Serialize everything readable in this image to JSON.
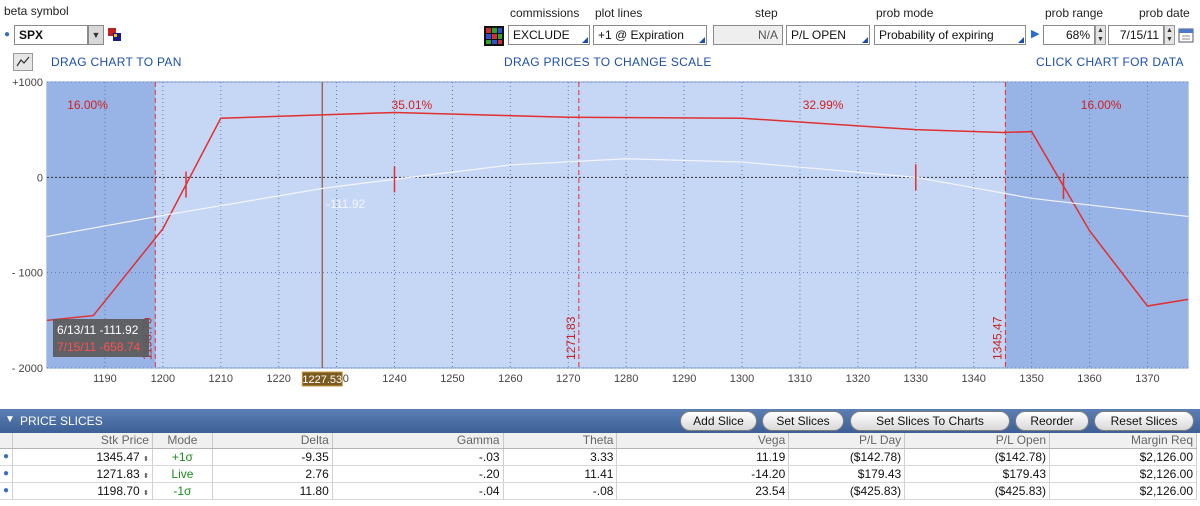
{
  "controls": {
    "beta_symbol_label": "beta symbol",
    "symbol": "SPX",
    "commissions_label": "commissions",
    "commissions_value": "EXCLUDE",
    "plot_lines_label": "plot lines",
    "plot_lines_value": "+1 @ Expiration",
    "step_label": "step",
    "step_value": "N/A",
    "pl_mode_value": "P/L OPEN",
    "prob_mode_label": "prob mode",
    "prob_mode_value": "Probability of expiring",
    "prob_range_label": "prob range",
    "prob_range_value": "68%",
    "prob_date_label": "prob date",
    "prob_date_value": "7/15/11"
  },
  "hints": {
    "pan": "DRAG CHART TO PAN",
    "scale": "DRAG PRICES TO CHANGE SCALE",
    "data": "CLICK CHART FOR DATA"
  },
  "chart_data": {
    "type": "line",
    "xlim": [
      1180,
      1377
    ],
    "ylim": [
      -2000,
      1000
    ],
    "x_ticks": [
      1190,
      1200,
      1210,
      1220,
      1230,
      1240,
      1250,
      1260,
      1270,
      1280,
      1290,
      1300,
      1310,
      1320,
      1330,
      1340,
      1350,
      1360,
      1370
    ],
    "y_ticks": [
      {
        "value": 1000,
        "label": "+1000"
      },
      {
        "value": 0,
        "label": "0"
      },
      {
        "value": -1000,
        "label": "- 1000"
      },
      {
        "value": -2000,
        "label": "- 2000"
      }
    ],
    "series": [
      {
        "color": "#e03030",
        "x": [
          1180,
          1188,
          1200,
          1210,
          1240,
          1270,
          1300,
          1330,
          1345,
          1350,
          1360,
          1370,
          1377
        ],
        "y": [
          -1500,
          -1450,
          -540,
          620,
          680,
          630,
          620,
          500,
          470,
          480,
          -560,
          -1350,
          -1280
        ]
      },
      {
        "color": "#f4f4ff",
        "x": [
          1180,
          1200,
          1228,
          1260,
          1280,
          1300,
          1330,
          1350,
          1377
        ],
        "y": [
          -620,
          -400,
          -112,
          130,
          195,
          160,
          0,
          -220,
          -410
        ]
      }
    ],
    "prob_lines": [
      1198.7,
      1271.83,
      1345.47
    ],
    "prob_line_labels": [
      "1198.70",
      "1271.83",
      "1345.47"
    ],
    "zone_pcts": [
      "16.00%",
      "35.01%",
      "32.99%",
      "16.00%"
    ],
    "zone_label_x": [
      1187,
      1243,
      1314,
      1362
    ],
    "breakeven_ticks": [
      {
        "x": 1204,
        "series": 0
      },
      {
        "x": 1240,
        "series": 1
      },
      {
        "x": 1330,
        "series": 1
      },
      {
        "x": 1355.5,
        "series": 0
      }
    ],
    "cursor": {
      "x": 1227.53,
      "label": "1227.53",
      "value_label": "-111.92"
    },
    "tooltip": {
      "line1": "6/13/11 -111.92",
      "line2": "7/15/11 -658.74"
    }
  },
  "slices": {
    "title": "PRICE SLICES",
    "buttons": [
      "Add Slice",
      "Set Slices",
      "Set Slices To Charts",
      "Reorder",
      "Reset Slices"
    ],
    "columns": [
      "Stk Price",
      "Mode",
      "Delta",
      "Gamma",
      "Theta",
      "Vega",
      "P/L Day",
      "P/L Open",
      "Margin Req"
    ],
    "rows": [
      [
        "1345.47",
        "+1σ",
        "-9.35",
        "-.03",
        "3.33",
        "11.19",
        "($142.78)",
        "($142.78)",
        "$2,126.00"
      ],
      [
        "1271.83",
        "Live",
        "2.76",
        "-.20",
        "11.41",
        "-14.20",
        "$179.43",
        "$179.43",
        "$2,126.00"
      ],
      [
        "1198.70",
        "-1σ",
        "11.80",
        "-.04",
        "-.08",
        "23.54",
        "($425.83)",
        "($425.83)",
        "$2,126.00"
      ]
    ]
  }
}
